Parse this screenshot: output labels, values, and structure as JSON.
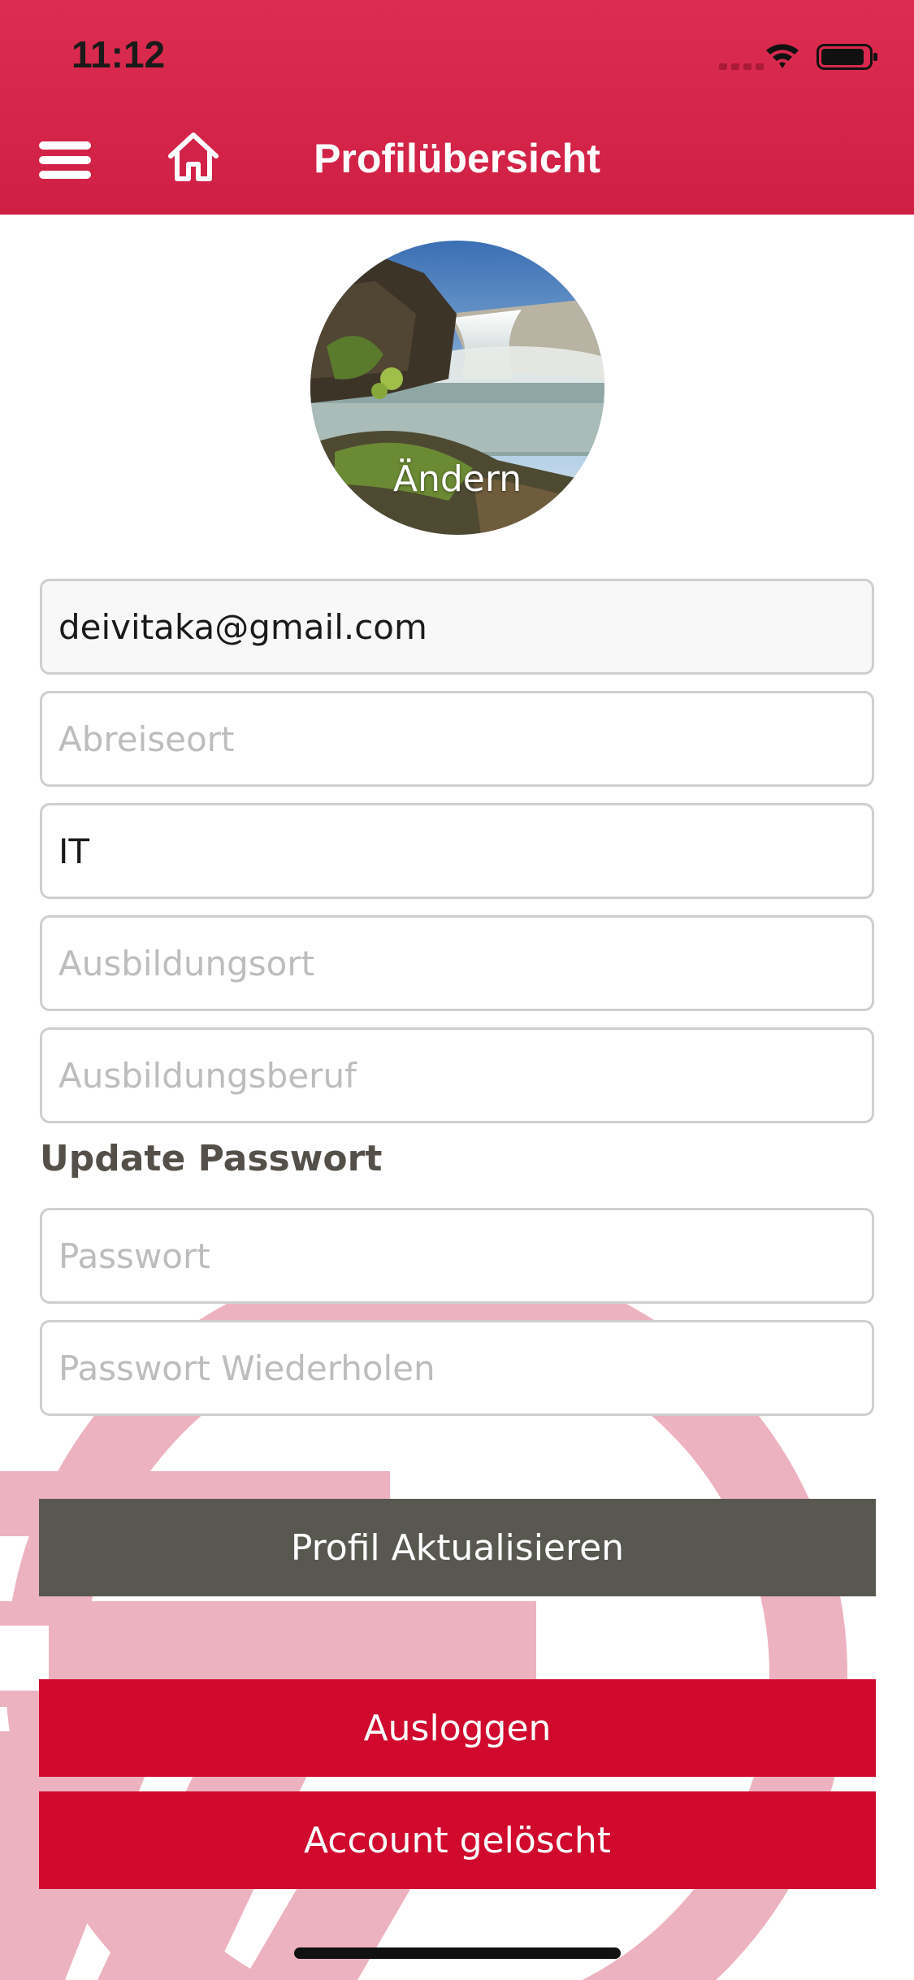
{
  "status_bar": {
    "time": "11:12",
    "icons": [
      "cellular-signal-icon",
      "wifi-icon",
      "battery-icon"
    ]
  },
  "header": {
    "title": "Profilübersicht",
    "menu_icon": "hamburger-menu-icon",
    "home_icon": "home-icon",
    "background_color": "#d42a4e"
  },
  "avatar": {
    "change_label": "Ändern",
    "image_subject": "waterfall landscape"
  },
  "form": {
    "email": {
      "value": "deivitaka@gmail.com",
      "placeholder": ""
    },
    "departure": {
      "value": "",
      "placeholder": "Abreiseort"
    },
    "country": {
      "value": "IT",
      "placeholder": ""
    },
    "training_place": {
      "value": "",
      "placeholder": "Ausbildungsort"
    },
    "training_job": {
      "value": "",
      "placeholder": "Ausbildungsberuf"
    }
  },
  "password_section": {
    "heading": "Update Passwort",
    "password": {
      "value": "",
      "placeholder": "Passwort"
    },
    "password_repeat": {
      "value": "",
      "placeholder": "Passwort Wiederholen"
    }
  },
  "buttons": {
    "update_profile": "Profil Aktualisieren",
    "logout": "Ausloggen",
    "delete_account": "Account gelöscht"
  },
  "colors": {
    "accent_red": "#d0092d",
    "button_gray": "#595850",
    "decoration_pink": "#edb2bf"
  }
}
